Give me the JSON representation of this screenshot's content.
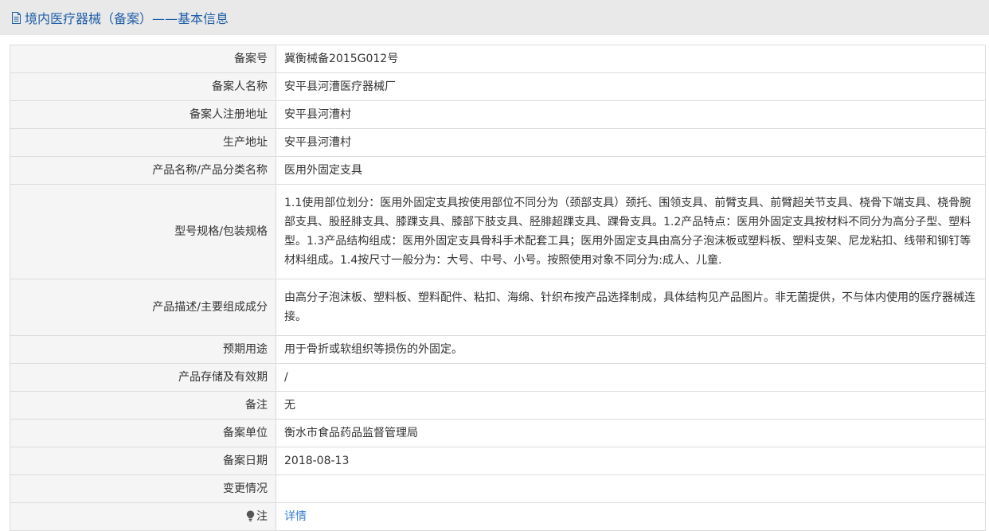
{
  "header": {
    "title": "境内医疗器械（备案）——基本信息",
    "icon": "document-icon",
    "color": "#1f5ea8"
  },
  "rows": {
    "record_no": {
      "label": "备案号",
      "value": "冀衡械备2015G012号"
    },
    "registrant_name": {
      "label": "备案人名称",
      "value": "安平县河漕医疗器械厂"
    },
    "registrant_address": {
      "label": "备案人注册地址",
      "value": "安平县河漕村"
    },
    "production_address": {
      "label": "生产地址",
      "value": "安平县河漕村"
    },
    "product_name": {
      "label": "产品名称/产品分类名称",
      "value": "医用外固定支具"
    },
    "model_spec": {
      "label": "型号规格/包装规格",
      "value": "1.1使用部位划分：医用外固定支具按使用部位不同分为（颈部支具）颈托、围领支具、前臂支具、前臂超关节支具、桡骨下端支具、桡骨腕部支具、股胫腓支具、膝踝支具、膝部下肢支具、胫腓超踝支具、踝骨支具。1.2产品特点：医用外固定支具按材料不同分为高分子型、塑料型。1.3产品结构组成：医用外固定支具骨科手术配套工具；医用外固定支具由高分子泡沫板或塑料板、塑料支架、尼龙粘扣、线带和铆钉等材料组成。1.4按尺寸一般分为：大号、中号、小号。按照使用对象不同分为:成人、儿童."
    },
    "description": {
      "label": "产品描述/主要组成成分",
      "value": "由高分子泡沫板、塑料板、塑料配件、粘扣、海绵、针织布按产品选择制成，具体结构见产品图片。非无菌提供，不与体内使用的医疗器械连接。"
    },
    "intended_use": {
      "label": "预期用途",
      "value": "用于骨折或软组织等损伤的外固定。"
    },
    "storage": {
      "label": "产品存储及有效期",
      "value": "/"
    },
    "remarks": {
      "label": "备注",
      "value": "无"
    },
    "record_unit": {
      "label": "备案单位",
      "value": "衡水市食品药品监督管理局"
    },
    "record_date": {
      "label": "备案日期",
      "value": "2018-08-13"
    },
    "changes": {
      "label": "变更情况",
      "value": ""
    },
    "note": {
      "label": "注",
      "icon": "lightbulb-icon",
      "link": "详情"
    }
  },
  "colors": {
    "label_bg": "#f5f5f5",
    "border": "#dcdcdc",
    "link": "#3b7fd0",
    "header_bg": "#e9e9e9"
  }
}
